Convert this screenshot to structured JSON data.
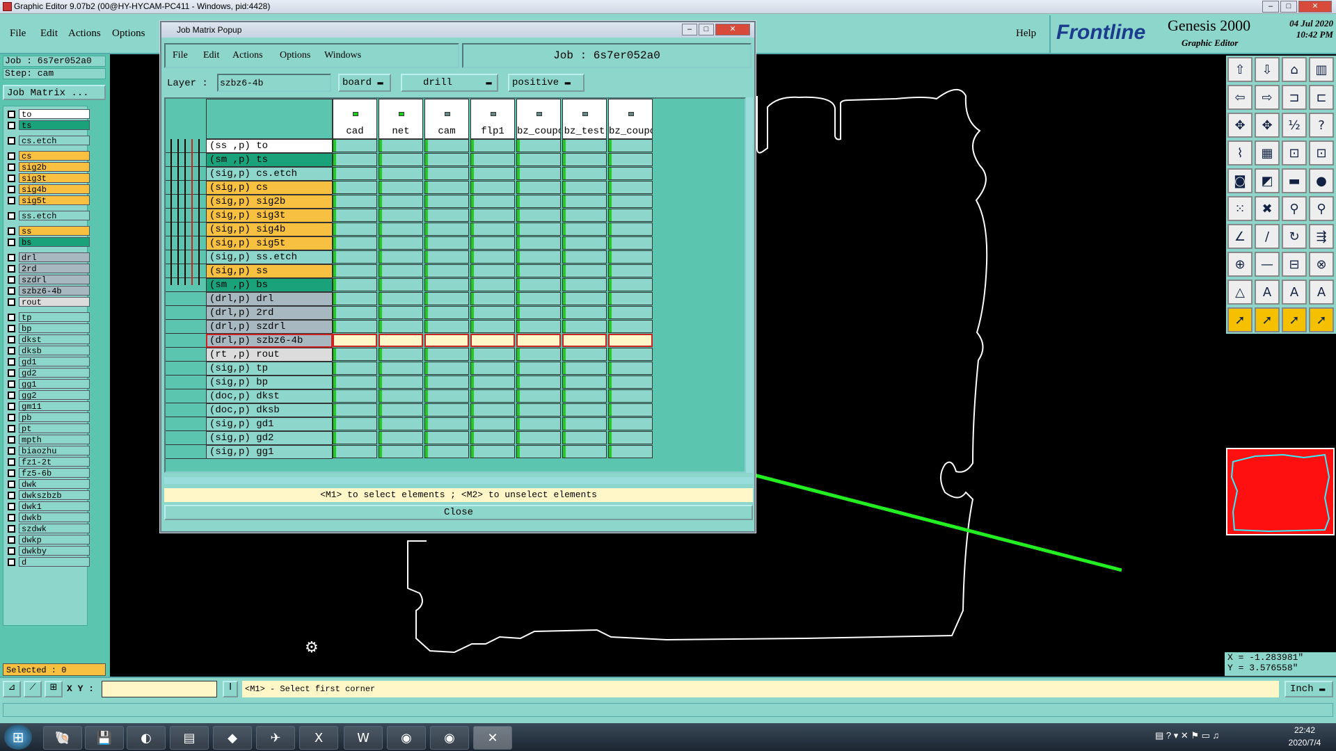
{
  "window": {
    "title": "Graphic Editor 9.07b2 (00@HY-HYCAM-PC411 - Windows, pid:4428)",
    "min": "–",
    "max": "□",
    "close": "✕"
  },
  "main_menu": [
    {
      "label": "File"
    },
    {
      "label": "Edit"
    },
    {
      "label": "Actions"
    },
    {
      "label": "Options"
    }
  ],
  "help_label": "Help",
  "brand": {
    "logo": "Frontline",
    "product": "Genesis 2000",
    "subtitle": "Graphic Editor",
    "date": "04 Jul 2020",
    "time": "10:42 PM"
  },
  "left": {
    "job": "Job : 6s7er052a0",
    "step": "Step: cam",
    "job_matrix_btn": "Job Matrix ...",
    "selected": "Selected : 0",
    "layers": [
      {
        "name": "to",
        "color": "#ffffff"
      },
      {
        "name": "ts",
        "color": "#1aa37a"
      },
      {
        "name": "cs.etch",
        "color": "#8cd6cc"
      },
      {
        "name": "cs",
        "color": "#f8c040"
      },
      {
        "name": "sig2b",
        "color": "#f8c040"
      },
      {
        "name": "sig3t",
        "color": "#f8c040"
      },
      {
        "name": "sig4b",
        "color": "#f8c040"
      },
      {
        "name": "sig5t",
        "color": "#f8c040"
      },
      {
        "name": "ss.etch",
        "color": "#8cd6cc"
      },
      {
        "name": "ss",
        "color": "#f8c040"
      },
      {
        "name": "bs",
        "color": "#1aa37a"
      },
      {
        "name": "drl",
        "color": "#a8b8c0"
      },
      {
        "name": "2rd",
        "color": "#a8b8c0"
      },
      {
        "name": "szdrl",
        "color": "#a8b8c0"
      },
      {
        "name": "szbz6-4b",
        "color": "#a8b8c0"
      },
      {
        "name": "rout",
        "color": "#dcdcdc"
      },
      {
        "name": "tp",
        "color": "#8cd6cc"
      },
      {
        "name": "bp",
        "color": "#8cd6cc"
      },
      {
        "name": "dkst",
        "color": "#8cd6cc"
      },
      {
        "name": "dksb",
        "color": "#8cd6cc"
      },
      {
        "name": "gd1",
        "color": "#8cd6cc"
      },
      {
        "name": "gd2",
        "color": "#8cd6cc"
      },
      {
        "name": "gg1",
        "color": "#8cd6cc"
      },
      {
        "name": "gg2",
        "color": "#8cd6cc"
      },
      {
        "name": "gm11",
        "color": "#8cd6cc"
      },
      {
        "name": "pb",
        "color": "#8cd6cc"
      },
      {
        "name": "pt",
        "color": "#8cd6cc"
      },
      {
        "name": "mpth",
        "color": "#8cd6cc"
      },
      {
        "name": "biaozhu",
        "color": "#8cd6cc"
      },
      {
        "name": "fz1-2t",
        "color": "#8cd6cc"
      },
      {
        "name": "fz5-6b",
        "color": "#8cd6cc"
      },
      {
        "name": "dwk",
        "color": "#8cd6cc"
      },
      {
        "name": "dwkszbzb",
        "color": "#8cd6cc"
      },
      {
        "name": "dwk1",
        "color": "#8cd6cc"
      },
      {
        "name": "dwkb",
        "color": "#8cd6cc"
      },
      {
        "name": "szdwk",
        "color": "#8cd6cc"
      },
      {
        "name": "dwkp",
        "color": "#8cd6cc"
      },
      {
        "name": "dwkby",
        "color": "#8cd6cc"
      },
      {
        "name": "d",
        "color": "#8cd6cc"
      }
    ]
  },
  "popup": {
    "title": "Job Matrix Popup",
    "menu": [
      {
        "label": "File"
      },
      {
        "label": "Edit"
      },
      {
        "label": "Actions"
      },
      {
        "label": "Options"
      },
      {
        "label": "Windows"
      }
    ],
    "job_label": "Job : 6s7er052a0",
    "layer_label": "Layer :",
    "layer_value": "szbz6-4b",
    "context": "board",
    "type": "drill",
    "polarity": "positive",
    "columns": [
      "cad",
      "net",
      "cam",
      "flp1",
      "bz_coupon",
      "bz_test",
      "bz_coupon"
    ],
    "rows": [
      {
        "label": "(ss ,p) to",
        "color": "#ffffff"
      },
      {
        "label": "(sm ,p) ts",
        "color": "#1aa37a"
      },
      {
        "label": "(sig,p) cs.etch",
        "color": "#8cd6cc"
      },
      {
        "label": "(sig,p) cs",
        "color": "#f8c040"
      },
      {
        "label": "(sig,p) sig2b",
        "color": "#f8c040"
      },
      {
        "label": "(sig,p) sig3t",
        "color": "#f8c040"
      },
      {
        "label": "(sig,p) sig4b",
        "color": "#f8c040"
      },
      {
        "label": "(sig,p) sig5t",
        "color": "#f8c040"
      },
      {
        "label": "(sig,p) ss.etch",
        "color": "#8cd6cc"
      },
      {
        "label": "(sig,p) ss",
        "color": "#f8c040"
      },
      {
        "label": "(sm ,p) bs",
        "color": "#1aa37a"
      },
      {
        "label": "(drl,p) drl",
        "color": "#a8b8c0"
      },
      {
        "label": "(drl,p) 2rd",
        "color": "#a8b8c0"
      },
      {
        "label": "(drl,p) szdrl",
        "color": "#a8b8c0"
      },
      {
        "label": "(drl,p) szbz6-4b",
        "color": "#a8b8c0"
      },
      {
        "label": "(rt ,p) rout",
        "color": "#dcdcdc"
      },
      {
        "label": "(sig,p) tp",
        "color": "#8cd6cc"
      },
      {
        "label": "(sig,p) bp",
        "color": "#8cd6cc"
      },
      {
        "label": "(doc,p) dkst",
        "color": "#8cd6cc"
      },
      {
        "label": "(doc,p) dksb",
        "color": "#8cd6cc"
      },
      {
        "label": "(sig,p) gd1",
        "color": "#8cd6cc"
      },
      {
        "label": "(sig,p) gd2",
        "color": "#8cd6cc"
      },
      {
        "label": "(sig,p) gg1",
        "color": "#8cd6cc"
      }
    ],
    "selected_row": 14,
    "hint": "<M1> to select elements ; <M2> to unselect elements",
    "close_label": "Close"
  },
  "bottom": {
    "xy_label": "X Y :",
    "xy_value": "",
    "status": "<M1> - Select first corner",
    "units": "Inch"
  },
  "coords": {
    "x": "X = -1.283981\"",
    "y": "Y = 3.576558\""
  },
  "taskbar": {
    "time": "22:42",
    "date": "2020/7/4"
  }
}
